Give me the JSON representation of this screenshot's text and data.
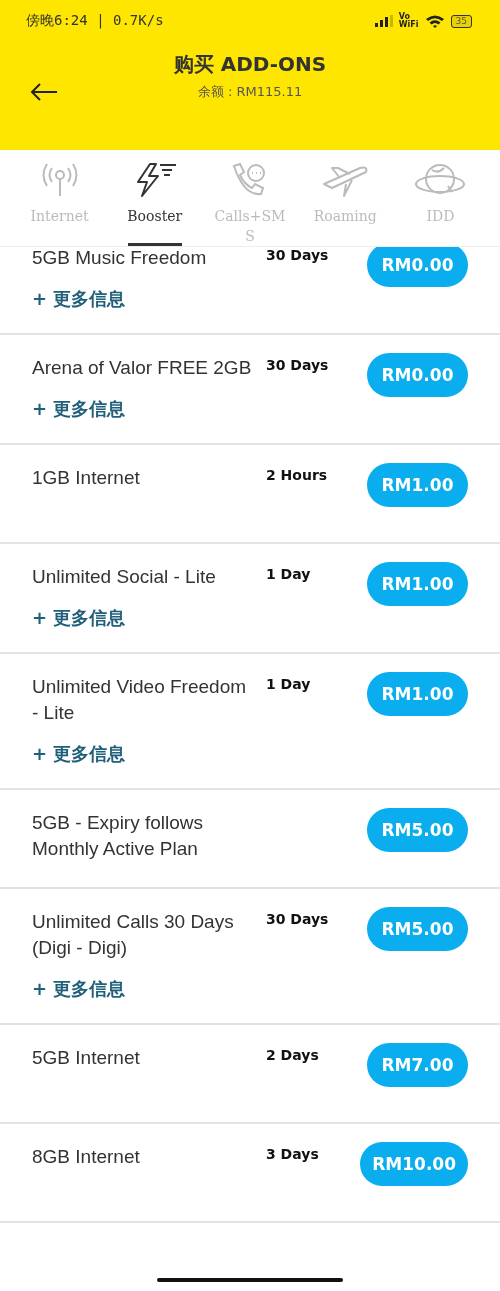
{
  "status_bar": {
    "time": "傍晚6:24 | 0.7K/s",
    "vowifi_top": "Vo",
    "vowifi_bottom": "WiFi",
    "battery": "35"
  },
  "header": {
    "title": "购买 ADD-ONS",
    "subtitle": "余额 : RM115.11"
  },
  "tabs": [
    {
      "label": "Internet",
      "selected": false
    },
    {
      "label": "Booster",
      "selected": true
    },
    {
      "label": "Calls+SMS",
      "selected": false
    },
    {
      "label": "Roaming",
      "selected": false
    },
    {
      "label": "IDD",
      "selected": false
    }
  ],
  "addons": [
    {
      "name": "5GB Music Freedom",
      "duration": "30 Days",
      "price": "RM0.00",
      "more_info": "+ 更多信息"
    },
    {
      "name": "Arena of Valor FREE 2GB",
      "duration": "30 Days",
      "price": "RM0.00",
      "more_info": "+ 更多信息"
    },
    {
      "name": "1GB Internet",
      "duration": "2 Hours",
      "price": "RM1.00"
    },
    {
      "name": "Unlimited Social - Lite",
      "duration": "1 Day",
      "price": "RM1.00",
      "more_info": "+ 更多信息"
    },
    {
      "name": "Unlimited Video Freedom - Lite",
      "duration": "1 Day",
      "price": "RM1.00",
      "more_info": "+ 更多信息"
    },
    {
      "name": "5GB - Expiry follows Monthly Active Plan",
      "price": "RM5.00"
    },
    {
      "name": "Unlimited Calls 30 Days (Digi - Digi)",
      "duration": "30 Days",
      "price": "RM5.00",
      "more_info": "+ 更多信息"
    },
    {
      "name": "5GB Internet",
      "duration": "2 Days",
      "price": "RM7.00"
    },
    {
      "name": "8GB Internet",
      "duration": "3 Days",
      "price": "RM10.00"
    }
  ]
}
